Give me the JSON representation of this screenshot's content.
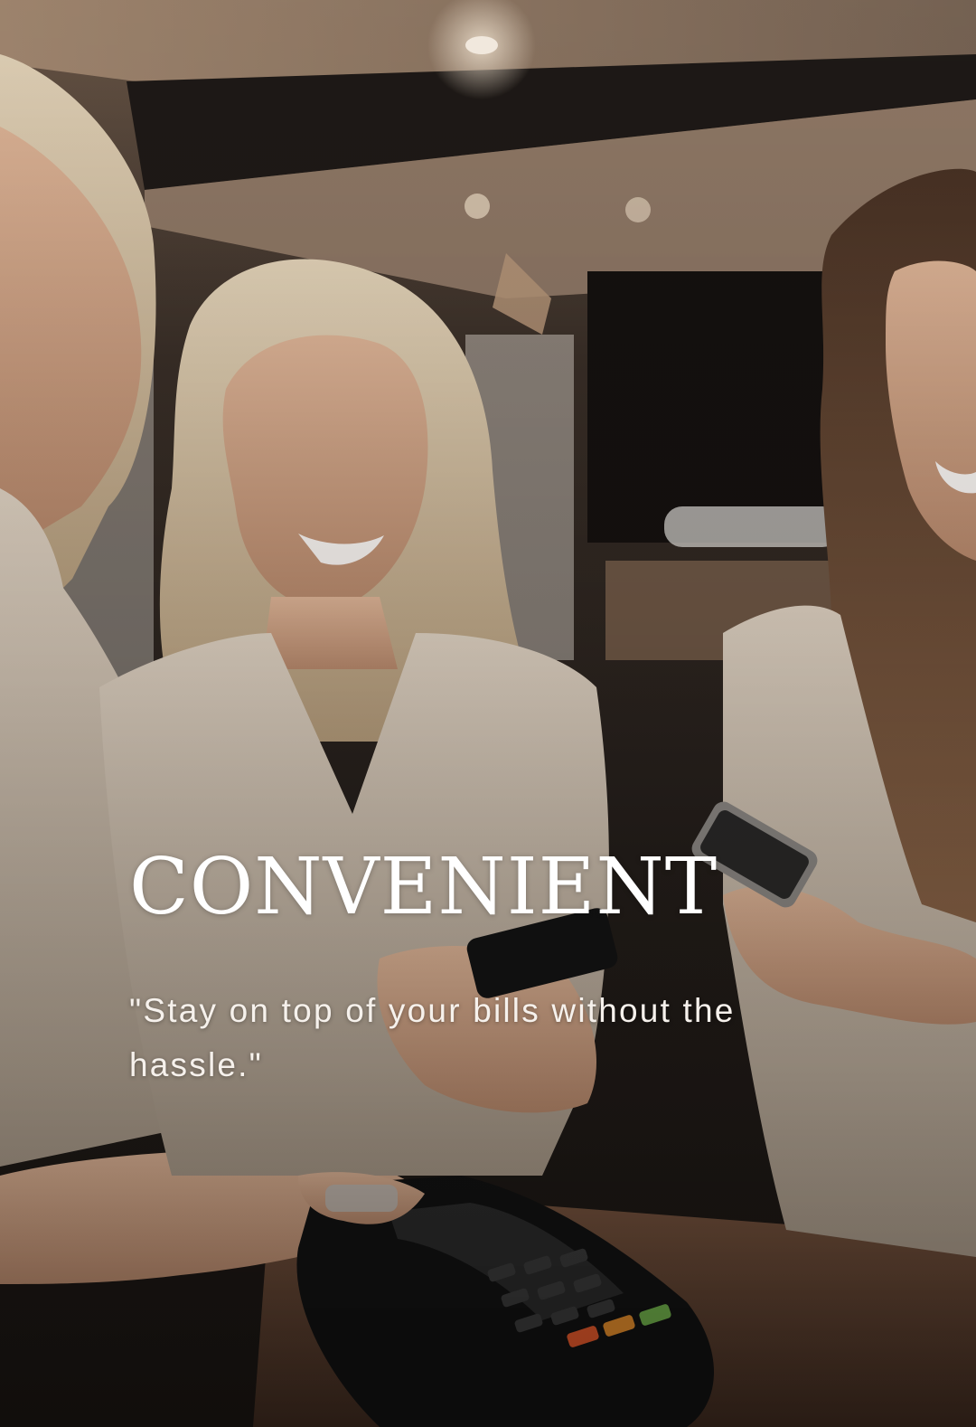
{
  "hero": {
    "headline": "CONVENIENT",
    "tagline": "\"Stay on top of your bills without the hassle.\""
  },
  "photo": {
    "subject": "three-women-paying-with-phones-at-card-terminal",
    "palette": {
      "background_dark": "#1c1815",
      "ceiling_wood": "#8d7461",
      "warm_light": "#e8d2b8",
      "skin": "#d2a488",
      "blonde_hair": "#d8c4a3",
      "brunette_hair": "#6a4a35",
      "blouse_cream": "#d9cdbf",
      "counter_wood": "#6b4a35",
      "terminal_black": "#121212"
    }
  }
}
